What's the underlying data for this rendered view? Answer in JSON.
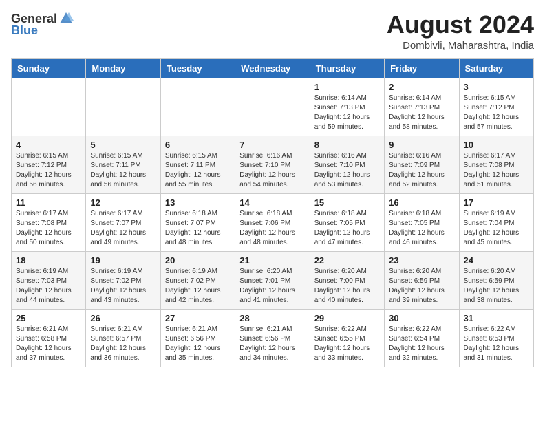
{
  "header": {
    "logo_general": "General",
    "logo_blue": "Blue",
    "month_title": "August 2024",
    "location": "Dombivli, Maharashtra, India"
  },
  "days_of_week": [
    "Sunday",
    "Monday",
    "Tuesday",
    "Wednesday",
    "Thursday",
    "Friday",
    "Saturday"
  ],
  "weeks": [
    [
      {
        "day": "",
        "info": ""
      },
      {
        "day": "",
        "info": ""
      },
      {
        "day": "",
        "info": ""
      },
      {
        "day": "",
        "info": ""
      },
      {
        "day": "1",
        "info": "Sunrise: 6:14 AM\nSunset: 7:13 PM\nDaylight: 12 hours\nand 59 minutes."
      },
      {
        "day": "2",
        "info": "Sunrise: 6:14 AM\nSunset: 7:13 PM\nDaylight: 12 hours\nand 58 minutes."
      },
      {
        "day": "3",
        "info": "Sunrise: 6:15 AM\nSunset: 7:12 PM\nDaylight: 12 hours\nand 57 minutes."
      }
    ],
    [
      {
        "day": "4",
        "info": "Sunrise: 6:15 AM\nSunset: 7:12 PM\nDaylight: 12 hours\nand 56 minutes."
      },
      {
        "day": "5",
        "info": "Sunrise: 6:15 AM\nSunset: 7:11 PM\nDaylight: 12 hours\nand 56 minutes."
      },
      {
        "day": "6",
        "info": "Sunrise: 6:15 AM\nSunset: 7:11 PM\nDaylight: 12 hours\nand 55 minutes."
      },
      {
        "day": "7",
        "info": "Sunrise: 6:16 AM\nSunset: 7:10 PM\nDaylight: 12 hours\nand 54 minutes."
      },
      {
        "day": "8",
        "info": "Sunrise: 6:16 AM\nSunset: 7:10 PM\nDaylight: 12 hours\nand 53 minutes."
      },
      {
        "day": "9",
        "info": "Sunrise: 6:16 AM\nSunset: 7:09 PM\nDaylight: 12 hours\nand 52 minutes."
      },
      {
        "day": "10",
        "info": "Sunrise: 6:17 AM\nSunset: 7:08 PM\nDaylight: 12 hours\nand 51 minutes."
      }
    ],
    [
      {
        "day": "11",
        "info": "Sunrise: 6:17 AM\nSunset: 7:08 PM\nDaylight: 12 hours\nand 50 minutes."
      },
      {
        "day": "12",
        "info": "Sunrise: 6:17 AM\nSunset: 7:07 PM\nDaylight: 12 hours\nand 49 minutes."
      },
      {
        "day": "13",
        "info": "Sunrise: 6:18 AM\nSunset: 7:07 PM\nDaylight: 12 hours\nand 48 minutes."
      },
      {
        "day": "14",
        "info": "Sunrise: 6:18 AM\nSunset: 7:06 PM\nDaylight: 12 hours\nand 48 minutes."
      },
      {
        "day": "15",
        "info": "Sunrise: 6:18 AM\nSunset: 7:05 PM\nDaylight: 12 hours\nand 47 minutes."
      },
      {
        "day": "16",
        "info": "Sunrise: 6:18 AM\nSunset: 7:05 PM\nDaylight: 12 hours\nand 46 minutes."
      },
      {
        "day": "17",
        "info": "Sunrise: 6:19 AM\nSunset: 7:04 PM\nDaylight: 12 hours\nand 45 minutes."
      }
    ],
    [
      {
        "day": "18",
        "info": "Sunrise: 6:19 AM\nSunset: 7:03 PM\nDaylight: 12 hours\nand 44 minutes."
      },
      {
        "day": "19",
        "info": "Sunrise: 6:19 AM\nSunset: 7:02 PM\nDaylight: 12 hours\nand 43 minutes."
      },
      {
        "day": "20",
        "info": "Sunrise: 6:19 AM\nSunset: 7:02 PM\nDaylight: 12 hours\nand 42 minutes."
      },
      {
        "day": "21",
        "info": "Sunrise: 6:20 AM\nSunset: 7:01 PM\nDaylight: 12 hours\nand 41 minutes."
      },
      {
        "day": "22",
        "info": "Sunrise: 6:20 AM\nSunset: 7:00 PM\nDaylight: 12 hours\nand 40 minutes."
      },
      {
        "day": "23",
        "info": "Sunrise: 6:20 AM\nSunset: 6:59 PM\nDaylight: 12 hours\nand 39 minutes."
      },
      {
        "day": "24",
        "info": "Sunrise: 6:20 AM\nSunset: 6:59 PM\nDaylight: 12 hours\nand 38 minutes."
      }
    ],
    [
      {
        "day": "25",
        "info": "Sunrise: 6:21 AM\nSunset: 6:58 PM\nDaylight: 12 hours\nand 37 minutes."
      },
      {
        "day": "26",
        "info": "Sunrise: 6:21 AM\nSunset: 6:57 PM\nDaylight: 12 hours\nand 36 minutes."
      },
      {
        "day": "27",
        "info": "Sunrise: 6:21 AM\nSunset: 6:56 PM\nDaylight: 12 hours\nand 35 minutes."
      },
      {
        "day": "28",
        "info": "Sunrise: 6:21 AM\nSunset: 6:56 PM\nDaylight: 12 hours\nand 34 minutes."
      },
      {
        "day": "29",
        "info": "Sunrise: 6:22 AM\nSunset: 6:55 PM\nDaylight: 12 hours\nand 33 minutes."
      },
      {
        "day": "30",
        "info": "Sunrise: 6:22 AM\nSunset: 6:54 PM\nDaylight: 12 hours\nand 32 minutes."
      },
      {
        "day": "31",
        "info": "Sunrise: 6:22 AM\nSunset: 6:53 PM\nDaylight: 12 hours\nand 31 minutes."
      }
    ]
  ]
}
